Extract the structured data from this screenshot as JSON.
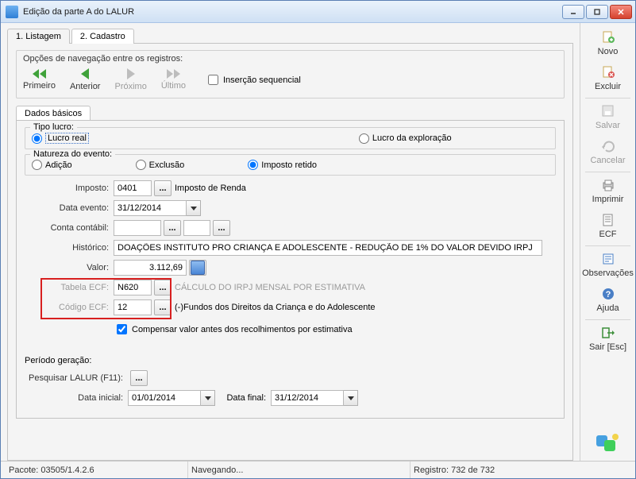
{
  "window": {
    "title": "Edição da parte A do LALUR"
  },
  "tabs": {
    "listagem": "1. Listagem",
    "cadastro": "2. Cadastro"
  },
  "nav": {
    "header": "Opções de navegação entre os registros:",
    "primeiro": "Primeiro",
    "anterior": "Anterior",
    "proximo": "Próximo",
    "ultimo": "Último",
    "insercao": "Inserção sequencial"
  },
  "inner_tab": "Dados básicos",
  "tipo_lucro": {
    "legend": "Tipo lucro:",
    "real": "Lucro real",
    "exploracao": "Lucro da exploração",
    "selected": "real"
  },
  "natureza": {
    "legend": "Natureza do evento:",
    "adicao": "Adição",
    "exclusao": "Exclusão",
    "imposto_retido": "Imposto retido",
    "selected": "imposto_retido"
  },
  "fields": {
    "imposto_label": "Imposto:",
    "imposto_value": "0401",
    "imposto_desc": "Imposto de Renda",
    "data_evento_label": "Data evento:",
    "data_evento_value": "31/12/2014",
    "conta_label": "Conta contábil:",
    "conta_value": "",
    "historico_label": "Histórico:",
    "historico_value": "DOAÇÕES INSTITUTO PRO CRIANÇA E ADOLESCENTE - REDUÇÃO DE 1% DO VALOR DEVIDO IRPJ",
    "valor_label": "Valor:",
    "valor_value": "3.112,69",
    "tabela_ecf_label": "Tabela ECF:",
    "tabela_ecf_value": "N620",
    "tabela_ecf_desc": "CÁLCULO DO IRPJ MENSAL POR ESTIMATIVA",
    "codigo_ecf_label": "Código ECF:",
    "codigo_ecf_value": "12",
    "codigo_ecf_desc": "(-)Fundos dos Direitos da Criança e do Adolescente",
    "compensar_label": "Compensar valor antes dos recolhimentos por estimativa"
  },
  "periodo": {
    "legend": "Período geração:",
    "pesquisar_label": "Pesquisar LALUR (F11):",
    "data_inicial_label": "Data inicial:",
    "data_inicial_value": "01/01/2014",
    "data_final_label": "Data final:",
    "data_final_value": "31/12/2014"
  },
  "sidebar": {
    "novo": "Novo",
    "excluir": "Excluir",
    "salvar": "Salvar",
    "cancelar": "Cancelar",
    "imprimir": "Imprimir",
    "ecf": "ECF",
    "observacoes": "Observações",
    "ajuda": "Ajuda",
    "sair": "Sair [Esc]"
  },
  "footer": {
    "pacote": "Pacote: 03505/1.4.2.6",
    "status": "Navegando...",
    "registro": "Registro: 732 de 732"
  },
  "chart_data": null
}
